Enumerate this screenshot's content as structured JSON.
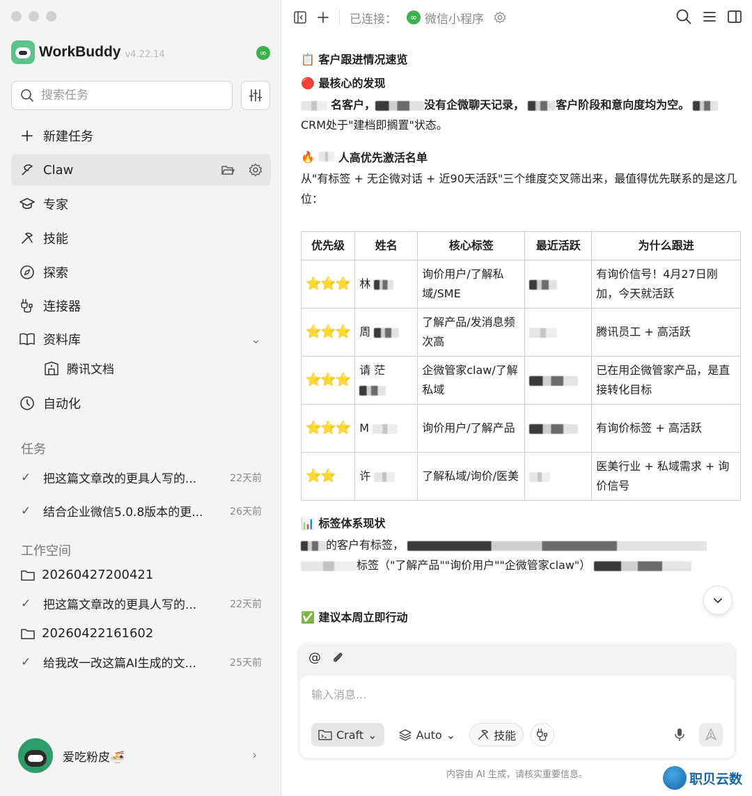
{
  "app": {
    "name": "WorkBuddy",
    "version": "v4.22.14"
  },
  "search": {
    "placeholder": "搜索任务"
  },
  "nav": [
    {
      "label": "新建任务"
    },
    {
      "label": "Claw"
    },
    {
      "label": "专家"
    },
    {
      "label": "技能"
    },
    {
      "label": "探索"
    },
    {
      "label": "连接器"
    },
    {
      "label": "资料库"
    },
    {
      "label": "自动化"
    }
  ],
  "library_sub": {
    "label": "腾讯文档"
  },
  "sections": {
    "tasks": "任务",
    "workspace": "工作空间"
  },
  "tasks": [
    {
      "title": "把这篇文章改的更具人写的...",
      "age": "22天前"
    },
    {
      "title": "结合企业微信5.0.8版本的更...",
      "age": "26天前"
    }
  ],
  "workspaces": [
    {
      "folder": "20260427200421",
      "task": {
        "title": "把这篇文章改的更具人写的...",
        "age": "22天前"
      }
    },
    {
      "folder": "20260422161602",
      "task": {
        "title": "给我改一改这篇AI生成的文...",
        "age": "25天前"
      }
    }
  ],
  "user": {
    "name": "爱吃粉皮🍜"
  },
  "topbar": {
    "connected_label": "已连接：",
    "connector": "微信小程序"
  },
  "article": {
    "h1": "📋 客户跟进情况速览",
    "h2": "🔴 最核心的发现",
    "p1_a": "名客户，",
    "p1_b": "没有企微聊天记录，",
    "p1_c": "客户阶段和意向度均为空。",
    "p1_d": "CRM处于\"建档即搁置\"状态。",
    "h3_icon": "🔥",
    "h3_text": "人高优先激活名单",
    "p2": "从\"有标签 + 无企微对话 + 近90天活跃\"三个维度交叉筛出来，最值得优先联系的是这几位：",
    "h4": "📊 标签体系现状",
    "p3_a": "的客户有标签，",
    "p3_b": "标签（\"了解产品\"\"询价用户\"\"企微管家claw\"）",
    "h5": "✅ 建议本周立即行动"
  },
  "table": {
    "headers": [
      "优先级",
      "姓名",
      "核心标签",
      "最近活跃",
      "为什么跟进"
    ],
    "rows": [
      {
        "priority": "⭐⭐⭐",
        "name": "林",
        "tags": "询价用户/了解私域/SME",
        "reason": "有询价信号！4月27日刚加，今天就活跃"
      },
      {
        "priority": "⭐⭐⭐",
        "name": "周",
        "tags": "了解产品/发消息频次高",
        "reason": "腾讯员工 + 高活跃"
      },
      {
        "priority": "⭐⭐⭐",
        "name": "请 茫",
        "tags": "企微管家claw/了解私域",
        "reason": "已在用企微管家产品，是直接转化目标"
      },
      {
        "priority": "⭐⭐⭐",
        "name": "M",
        "tags": "询价用户/了解产品",
        "reason": "有询价标签 + 高活跃"
      },
      {
        "priority": "⭐⭐",
        "name": "许",
        "tags": "了解私域/询价/医美",
        "reason": "医美行业 + 私域需求 + 询价信号"
      }
    ]
  },
  "composer": {
    "placeholder": "输入消息...",
    "mode": "Craft",
    "model": "Auto",
    "skills": "技能"
  },
  "disclaimer": "内容由 AI 生成，请核实重要信息。",
  "watermark": "职贝云数",
  "colors": {
    "accent_green": "#3bb34a",
    "sidebar_bg": "#f4f4f4",
    "active_bg": "#e6e6e6",
    "star": "#f5c518"
  }
}
